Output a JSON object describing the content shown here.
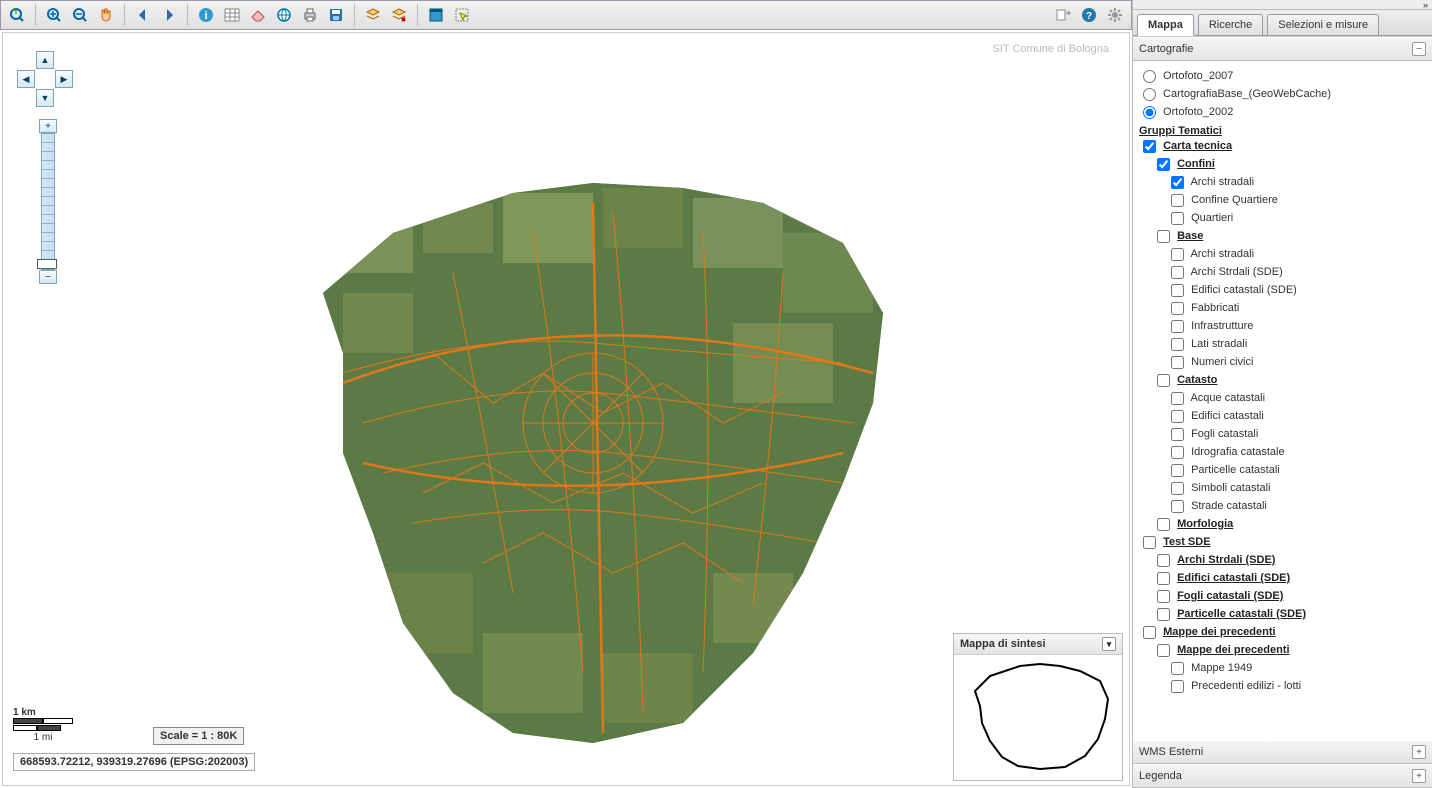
{
  "toolbar_icons": [
    "zoom-extent",
    "zoom-in",
    "zoom-out",
    "pan",
    "prev",
    "next",
    "identify",
    "table",
    "eraser",
    "measure-tool",
    "print",
    "save",
    "layer1",
    "layer2",
    "window",
    "select"
  ],
  "toolbar_right_icons": [
    "export",
    "help",
    "settings"
  ],
  "attribution": "SIT Comune di Bologna",
  "scale": {
    "km_label": "1 km",
    "mi_label": "1 mi",
    "text": "Scale = 1 : 80K"
  },
  "coords": "668593.72212, 939319.27696 (EPSG:202003)",
  "overview": {
    "title": "Mappa di sintesi"
  },
  "tabs": [
    "Mappa",
    "Ricerche",
    "Selezioni e misure"
  ],
  "active_tab": 0,
  "accordion": {
    "cartografie": "Cartografie",
    "wms": "WMS Esterni",
    "legenda": "Legenda"
  },
  "basemaps": [
    {
      "label": "Ortofoto_2007",
      "checked": false
    },
    {
      "label": "CartografiaBase_(GeoWebCache)",
      "checked": false
    },
    {
      "label": "Ortofoto_2002",
      "checked": true
    }
  ],
  "gruppi_title": "Gruppi Tematici",
  "groups": [
    {
      "label": "Carta tecnica",
      "checked": true,
      "children": [
        {
          "label": "Confini",
          "checked": true,
          "bold": true,
          "children": [
            {
              "label": "Archi stradali",
              "checked": true
            },
            {
              "label": "Confine Quartiere",
              "checked": false
            },
            {
              "label": "Quartieri",
              "checked": false
            }
          ]
        },
        {
          "label": "Base",
          "checked": false,
          "bold": true,
          "children": [
            {
              "label": "Archi stradali",
              "checked": false
            },
            {
              "label": "Archi Strdali (SDE)",
              "checked": false
            },
            {
              "label": "Edifici catastali (SDE)",
              "checked": false
            },
            {
              "label": "Fabbricati",
              "checked": false
            },
            {
              "label": "Infrastrutture",
              "checked": false
            },
            {
              "label": "Lati stradali",
              "checked": false
            },
            {
              "label": "Numeri civici",
              "checked": false
            }
          ]
        },
        {
          "label": "Catasto",
          "checked": false,
          "bold": true,
          "children": [
            {
              "label": "Acque catastali",
              "checked": false
            },
            {
              "label": "Edifici catastali",
              "checked": false
            },
            {
              "label": "Fogli catastali",
              "checked": false
            },
            {
              "label": "Idrografia catastale",
              "checked": false
            },
            {
              "label": "Particelle catastali",
              "checked": false
            },
            {
              "label": "Simboli catastali",
              "checked": false
            },
            {
              "label": "Strade catastali",
              "checked": false
            }
          ]
        },
        {
          "label": "Morfologia",
          "checked": false,
          "bold": true,
          "children": []
        }
      ]
    },
    {
      "label": "Test SDE",
      "checked": false,
      "children": [
        {
          "label": "Archi Strdali (SDE)",
          "checked": false
        },
        {
          "label": "Edifici catastali (SDE)",
          "checked": false
        },
        {
          "label": "Fogli catastali (SDE)",
          "checked": false
        },
        {
          "label": "Particelle catastali (SDE)",
          "checked": false
        }
      ]
    },
    {
      "label": "Mappe dei precedenti",
      "checked": false,
      "children": [
        {
          "label": "Mappe dei precedenti",
          "checked": false,
          "bold": true,
          "children": [
            {
              "label": "Mappe 1949",
              "checked": false
            },
            {
              "label": "Precedenti edilizi - lotti",
              "checked": false
            }
          ]
        }
      ]
    }
  ]
}
